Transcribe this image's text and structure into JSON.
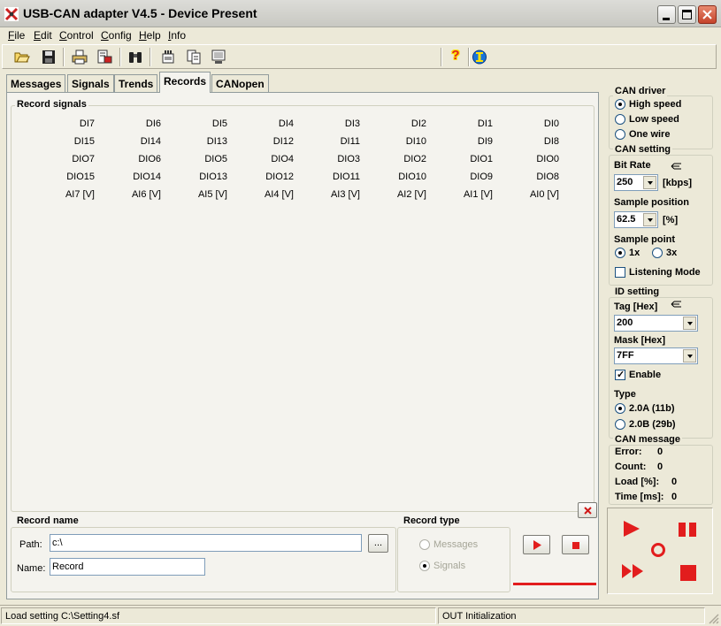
{
  "window": {
    "title": "USB-CAN adapter  V4.5  -  Device Present"
  },
  "menu": [
    "File",
    "Edit",
    "Control",
    "Config",
    "Help",
    "Info"
  ],
  "tabs": [
    "Messages",
    "Signals",
    "Trends",
    "Records",
    "CANopen"
  ],
  "active_tab": "Records",
  "record_signals": {
    "title": "Record signals",
    "rows": [
      [
        "DI7",
        "DI6",
        "DI5",
        "DI4",
        "DI3",
        "DI2",
        "DI1",
        "DI0"
      ],
      [
        "DI15",
        "DI14",
        "DI13",
        "DI12",
        "DI11",
        "DI10",
        "DI9",
        "DI8"
      ],
      [
        "DIO7",
        "DIO6",
        "DIO5",
        "DIO4",
        "DIO3",
        "DIO2",
        "DIO1",
        "DIO0"
      ],
      [
        "DIO15",
        "DIO14",
        "DIO13",
        "DIO12",
        "DIO11",
        "DIO10",
        "DIO9",
        "DIO8"
      ],
      [
        "AI7 [V]",
        "AI6 [V]",
        "AI5 [V]",
        "AI4 [V]",
        "AI3 [V]",
        "AI2 [V]",
        "AI1 [V]",
        "AI0 [V]"
      ]
    ]
  },
  "record_name": {
    "title": "Record name",
    "path_label": "Path:",
    "path_value": "c:\\",
    "browse_label": "...",
    "name_label": "Name:",
    "name_value": "Record"
  },
  "record_type": {
    "title": "Record type",
    "options": [
      "Messages",
      "Signals"
    ],
    "selected": "Signals"
  },
  "can_driver": {
    "title": "CAN driver",
    "options": [
      "High speed",
      "Low speed",
      "One wire"
    ],
    "selected": "High speed"
  },
  "can_setting": {
    "title": "CAN setting",
    "bit_rate_label": "Bit Rate",
    "bit_rate_value": "250",
    "bit_rate_unit": "[kbps]",
    "sample_position_label": "Sample position",
    "sample_position_value": "62.5",
    "sample_position_unit": "[%]",
    "sample_point_label": "Sample point",
    "sample_point_options": [
      "1x",
      "3x"
    ],
    "sample_point_selected": "1x",
    "listening_mode_label": "Listening Mode",
    "listening_mode_checked": false
  },
  "id_setting": {
    "title": "ID setting",
    "tag_label": "Tag [Hex]",
    "tag_value": "200",
    "mask_label": "Mask [Hex]",
    "mask_value": "7FF",
    "enable_label": "Enable",
    "enable_checked": true,
    "type_label": "Type",
    "type_options": [
      "2.0A (11b)",
      "2.0B (29b)"
    ],
    "type_selected": "2.0A (11b)"
  },
  "can_message": {
    "title": "CAN message",
    "stats": [
      {
        "label": "Error:",
        "value": "0"
      },
      {
        "label": "Count:",
        "value": "0"
      },
      {
        "label": "Load [%]:",
        "value": "0"
      },
      {
        "label": "Time [ms]:",
        "value": "0"
      }
    ]
  },
  "status": {
    "left": "Load setting C:\\Setting4.sf",
    "right": "OUT Initialization"
  },
  "colors": {
    "accent_red": "#e21d1d",
    "help_yellow": "#ffe000",
    "info_blue": "#1a74d8"
  },
  "icons": {
    "toolbar": [
      "open-folder-icon",
      "save-disk-icon",
      "print-icon",
      "print-preview-icon",
      "find-binoculars-icon",
      "device-icon",
      "copy-pages-icon",
      "monitor-icon",
      "help-icon",
      "info-icon"
    ],
    "player": [
      "play-icon",
      "pause-icon",
      "record-icon",
      "fast-forward-icon",
      "stop-icon"
    ]
  }
}
